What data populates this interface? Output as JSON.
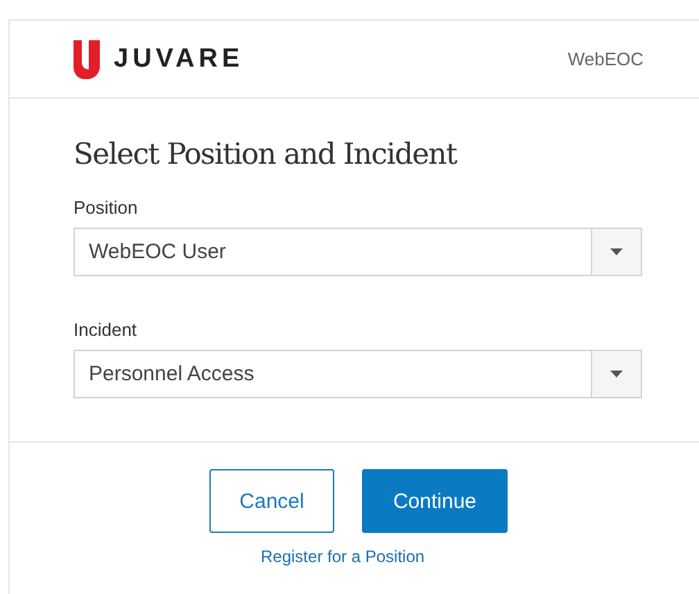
{
  "header": {
    "brand": "JUVARE",
    "product": "WebEOC"
  },
  "title": "Select Position and Incident",
  "fields": [
    {
      "label": "Position",
      "value": "WebEOC User"
    },
    {
      "label": "Incident",
      "value": "Personnel Access"
    }
  ],
  "buttons": [
    {
      "label": "Cancel",
      "kind": "secondary"
    },
    {
      "label": "Continue",
      "kind": "primary"
    }
  ],
  "link": "Register for a Position"
}
